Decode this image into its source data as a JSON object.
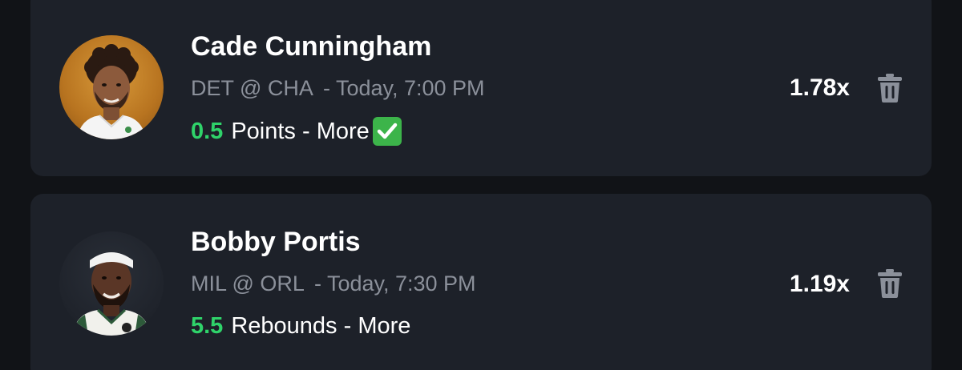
{
  "picks": [
    {
      "player": "Cade Cunningham",
      "matchup": "DET @ CHA",
      "time": "- Today, 7:00 PM",
      "line": "0.5",
      "stat": "Points - More",
      "status_icon": "check-mark-icon",
      "multiplier": "1.78x",
      "avatar_bg": "#c98a2e"
    },
    {
      "player": "Bobby Portis",
      "matchup": "MIL @ ORL",
      "time": "- Today, 7:30 PM",
      "line": "5.5",
      "stat": "Rebounds - More",
      "multiplier": "1.19x",
      "avatar_bg": "#232730"
    }
  ],
  "colors": {
    "background": "#111317",
    "card": "#1d2129",
    "accent_green": "#2fd36a",
    "muted_text": "#8b909a"
  }
}
